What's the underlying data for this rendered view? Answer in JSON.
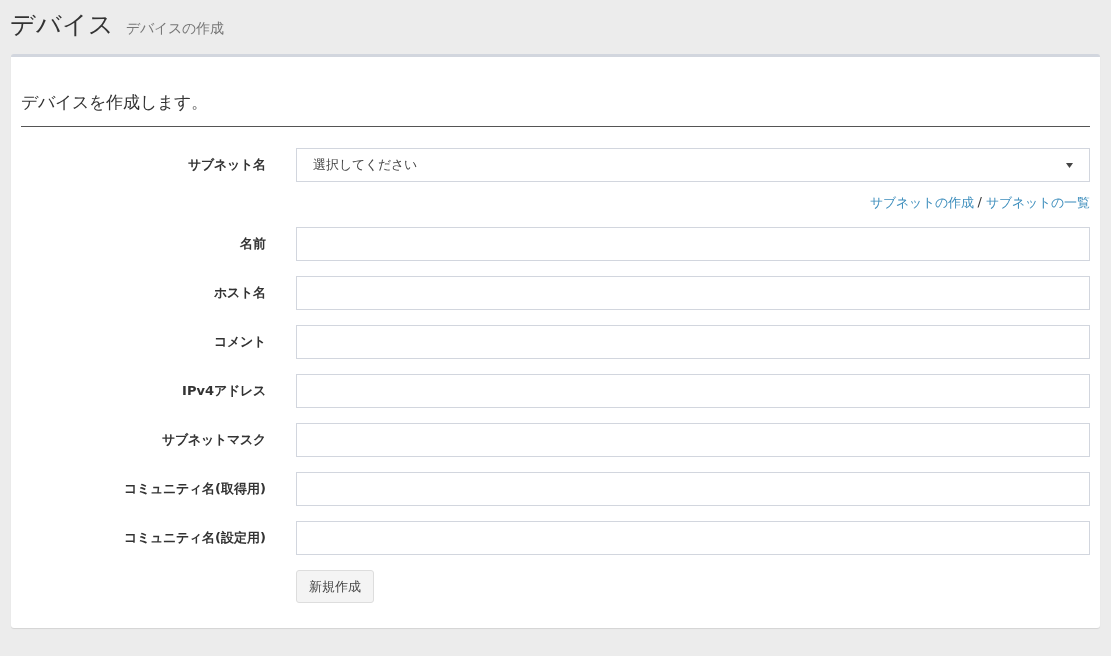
{
  "page": {
    "title": "デバイス",
    "subtitle": "デバイスの作成"
  },
  "panel": {
    "heading": "デバイスを作成します。"
  },
  "fields": [
    {
      "kind": "select",
      "label": "サブネット名",
      "value": "選択してください",
      "links": [
        "サブネットの作成",
        "サブネットの一覧"
      ],
      "separator": "/"
    },
    {
      "kind": "text",
      "label": "名前"
    },
    {
      "kind": "text",
      "label": "ホスト名"
    },
    {
      "kind": "text",
      "label": "コメント"
    },
    {
      "kind": "text",
      "label": "IPv4アドレス"
    },
    {
      "kind": "text",
      "label": "サブネットマスク"
    },
    {
      "kind": "text",
      "label": "コミュニティ名(取得用)"
    },
    {
      "kind": "text",
      "label": "コミュニティ名(設定用)"
    }
  ],
  "submit": {
    "label": "新規作成"
  }
}
